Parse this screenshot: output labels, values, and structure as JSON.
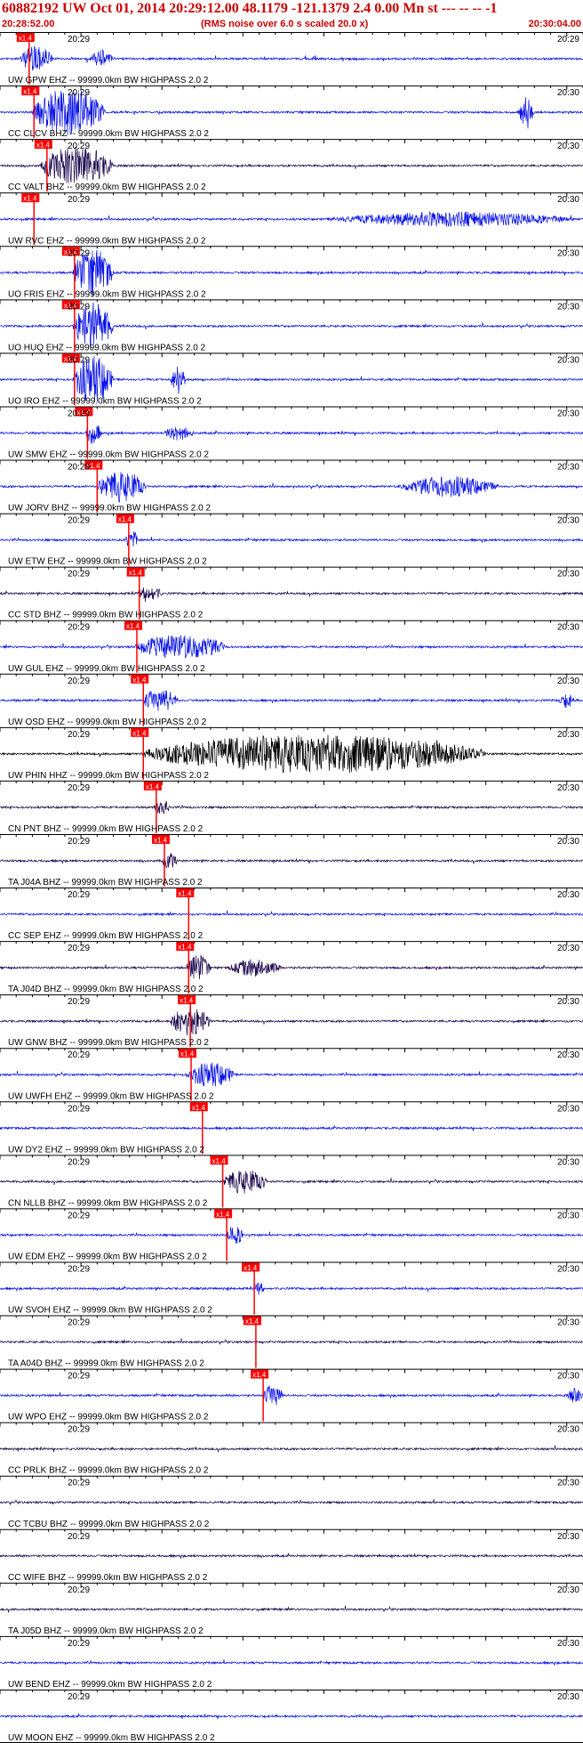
{
  "header": {
    "title": "60882192 UW Oct 01, 2014 20:29:12.00   48.1179 -121.1379  2.4 0.00 Mn st --- -- --   -1",
    "start_time": "20:28:52.00",
    "note": "(RMS noise over 6.0 s scaled 20.0 x)",
    "end_time": "20:30:04.00"
  },
  "colors": {
    "header_text": "#cc0000",
    "trace_blue": "#0a14e6",
    "trace_dark": "#1e0a50",
    "trace_black": "#000000",
    "pick": "#ff0000",
    "pick_label": "#ffffff"
  },
  "chart_data": {
    "type": "seismogram",
    "time_range": [
      "20:28:52.00",
      "20:30:04.00"
    ],
    "time_range_seconds": [
      0,
      72
    ],
    "pick_label": "x1.4",
    "traces": [
      {
        "label": "UW GPW EHZ -- 99999.0km BW  HIGHPASS  2.0  2",
        "time_labels": [
          "20:29",
          "20:29"
        ],
        "color": "blue",
        "pick_s": 3.6,
        "burst_s": [
          2.5,
          6.5
        ],
        "late_s": [
          11,
          14
        ],
        "amp": 0.55
      },
      {
        "label": "CC CLCV BHZ -- 99999.0km BW  HIGHPASS  2.0  2",
        "time_labels": [
          "20:29",
          "20:30"
        ],
        "color": "blue",
        "pick_s": 4.2,
        "burst_s": [
          4,
          13
        ],
        "late_s": [
          64,
          66
        ],
        "amp": 1.0
      },
      {
        "label": "CC VALT BHZ -- 99999.0km BW  HIGHPASS  2.0  2",
        "time_labels": [
          "20:29",
          "20:30"
        ],
        "color": "dark",
        "pick_s": 5.8,
        "burst_s": [
          5,
          14
        ],
        "late_s": [],
        "amp": 0.8
      },
      {
        "label": "UW RVC EHZ -- 99999.0km BW  HIGHPASS  2.0  2",
        "time_labels": [
          "20:29",
          "20:30"
        ],
        "color": "blue",
        "pick_s": 4.2,
        "burst_s": [],
        "late_s": [
          40,
          72
        ],
        "amp": 0.45
      },
      {
        "label": "UO FRIS EHZ -- 99999.0km BW  HIGHPASS  2.0  2",
        "time_labels": [
          "20:29",
          "20:30"
        ],
        "color": "blue",
        "pick_s": 9.2,
        "burst_s": [
          9,
          14
        ],
        "late_s": [],
        "amp": 1.0
      },
      {
        "label": "UO HUQ EHZ -- 99999.0km BW  HIGHPASS  2.0  2",
        "time_labels": [
          "20:29",
          "20:30"
        ],
        "color": "blue",
        "pick_s": 9.2,
        "burst_s": [
          9,
          14
        ],
        "late_s": [],
        "amp": 1.0
      },
      {
        "label": "UO IRO EHZ -- 99999.0km BW  HIGHPASS  2.0  2",
        "time_labels": [
          "20:29",
          "20:30"
        ],
        "color": "blue",
        "pick_s": 9.2,
        "burst_s": [
          9,
          14
        ],
        "late_s": [
          21,
          23
        ],
        "amp": 1.0
      },
      {
        "label": "UW SMW EHZ -- 99999.0km BW  HIGHPASS  2.0  2",
        "time_labels": [
          "20:29",
          "20:30"
        ],
        "color": "blue",
        "pick_s": 10.8,
        "burst_s": [
          10.5,
          12.5
        ],
        "late_s": [
          20,
          24
        ],
        "amp": 0.45
      },
      {
        "label": "UW JORV BHZ -- 99999.0km BW  HIGHPASS  2.0  2",
        "time_labels": [
          "20:29",
          "20:30"
        ],
        "color": "blue",
        "pick_s": 12.0,
        "burst_s": [
          12,
          18
        ],
        "late_s": [
          49,
          62
        ],
        "amp": 0.65
      },
      {
        "label": "UW ETW EHZ -- 99999.0km BW  HIGHPASS  2.0  2",
        "time_labels": [
          "20:29",
          "20:30"
        ],
        "color": "blue",
        "pick_s": 15.9,
        "burst_s": [
          15.5,
          17
        ],
        "late_s": [],
        "amp": 0.4
      },
      {
        "label": "CC STD BHZ -- 99999.0km BW  HIGHPASS  2.0  2",
        "time_labels": [
          "20:29",
          "20:30"
        ],
        "color": "dark",
        "pick_s": 17.2,
        "burst_s": [
          17,
          20
        ],
        "late_s": [],
        "amp": 0.3
      },
      {
        "label": "UW GUL EHZ -- 99999.0km BW  HIGHPASS  2.0  2",
        "time_labels": [
          "20:29",
          "20:30"
        ],
        "color": "blue",
        "pick_s": 16.9,
        "burst_s": [
          16.5,
          28
        ],
        "late_s": [],
        "amp": 0.5
      },
      {
        "label": "UW OSD EHZ -- 99999.0km BW  HIGHPASS  2.0  2",
        "time_labels": [
          "20:29",
          "20:30"
        ],
        "color": "blue",
        "pick_s": 17.7,
        "burst_s": [
          17.5,
          22
        ],
        "late_s": [
          69,
          71
        ],
        "amp": 0.45
      },
      {
        "label": "UW PHIN HHZ -- 99999.0km BW  HIGHPASS  2.0  2",
        "time_labels": [
          "20:29",
          "20:30"
        ],
        "color": "black",
        "pick_s": 17.7,
        "burst_s": [
          17.5,
          60
        ],
        "late_s": [],
        "amp": 0.8
      },
      {
        "label": "CN PNT BHZ -- 99999.0km BW  HIGHPASS  2.0  2",
        "time_labels": [
          "20:29",
          "20:30"
        ],
        "color": "dark",
        "pick_s": 19.3,
        "burst_s": [
          19,
          21
        ],
        "late_s": [],
        "amp": 0.3
      },
      {
        "label": "TA J04A BHZ -- 99999.0km BW  HIGHPASS  2.0  2",
        "time_labels": [
          "20:29",
          "20:30"
        ],
        "color": "dark",
        "pick_s": 20.3,
        "burst_s": [
          20,
          22
        ],
        "late_s": [],
        "amp": 0.3
      },
      {
        "label": "CC SEP EHZ -- 99999.0km BW  HIGHPASS  2.0  2",
        "time_labels": [
          "20:29",
          "20:30"
        ],
        "color": "blue",
        "pick_s": 23.3,
        "burst_s": [],
        "late_s": [],
        "amp": 0.15
      },
      {
        "label": "TA J04D BHZ -- 99999.0km BW  HIGHPASS  2.0  2",
        "time_labels": [
          "20:29",
          "20:30"
        ],
        "color": "dark",
        "pick_s": 23.3,
        "burst_s": [
          23,
          26
        ],
        "late_s": [
          28,
          35
        ],
        "amp": 0.55
      },
      {
        "label": "UW GNW BHZ -- 99999.0km BW  HIGHPASS  2.0  2",
        "time_labels": [
          "20:29",
          "20:30"
        ],
        "color": "dark",
        "pick_s": 23.5,
        "burst_s": [
          21,
          26
        ],
        "late_s": [],
        "amp": 0.6
      },
      {
        "label": "UW UWFH EHZ -- 99999.0km BW  HIGHPASS  2.0  2",
        "time_labels": [
          "20:29",
          "20:30"
        ],
        "color": "blue",
        "pick_s": 23.6,
        "burst_s": [
          23,
          29
        ],
        "late_s": [],
        "amp": 0.5
      },
      {
        "label": "UW DY2 EHZ -- 99999.0km BW  HIGHPASS  2.0  2",
        "time_labels": [
          "20:29",
          "20:30"
        ],
        "color": "blue",
        "pick_s": 25.0,
        "burst_s": [],
        "late_s": [],
        "amp": 0.2
      },
      {
        "label": "CN NLLB BHZ -- 99999.0km BW  HIGHPASS  2.0  2",
        "time_labels": [
          "20:29",
          "20:30"
        ],
        "color": "dark",
        "pick_s": 27.5,
        "burst_s": [
          27.5,
          33
        ],
        "late_s": [],
        "amp": 0.5
      },
      {
        "label": "UW EDM EHZ -- 99999.0km BW  HIGHPASS  2.0  2",
        "time_labels": [
          "20:29",
          "20:30"
        ],
        "color": "blue",
        "pick_s": 28.0,
        "burst_s": [
          28,
          30
        ],
        "late_s": [],
        "amp": 0.4
      },
      {
        "label": "UW SVOH EHZ -- 99999.0km BW  HIGHPASS  2.0  2",
        "time_labels": [
          "20:29",
          "20:30"
        ],
        "color": "blue",
        "pick_s": 31.4,
        "burst_s": [
          31.5,
          32.5
        ],
        "late_s": [],
        "amp": 0.3
      },
      {
        "label": "TA A04D BHZ -- 99999.0km BW  HIGHPASS  2.0  2",
        "time_labels": [
          "20:29",
          "20:30"
        ],
        "color": "dark",
        "pick_s": 31.6,
        "burst_s": [],
        "late_s": [],
        "amp": 0.25
      },
      {
        "label": "UW WPO EHZ -- 99999.0km BW  HIGHPASS  2.0  2",
        "time_labels": [
          "20:29",
          "20:30"
        ],
        "color": "blue",
        "pick_s": 32.5,
        "burst_s": [
          32.5,
          35
        ],
        "late_s": [
          70,
          72
        ],
        "amp": 0.45
      },
      {
        "label": "CC PRLK BHZ -- 99999.0km BW  HIGHPASS  2.0  2",
        "time_labels": [
          "20:29",
          "20:30"
        ],
        "color": "dark",
        "pick_s": null,
        "burst_s": [],
        "late_s": [],
        "amp": 0.25
      },
      {
        "label": "CC TCBU BHZ -- 99999.0km BW  HIGHPASS  2.0  2",
        "time_labels": [
          "20:29",
          "20:30"
        ],
        "color": "dark",
        "pick_s": null,
        "burst_s": [],
        "late_s": [],
        "amp": 0.25
      },
      {
        "label": "CC WIFE BHZ -- 99999.0km BW  HIGHPASS  2.0  2",
        "time_labels": [
          "20:29",
          "20:30"
        ],
        "color": "dark",
        "pick_s": null,
        "burst_s": [],
        "late_s": [],
        "amp": 0.25
      },
      {
        "label": "TA J05D BHZ -- 99999.0km BW  HIGHPASS  2.0  2",
        "time_labels": [
          "20:29",
          "20:30"
        ],
        "color": "dark",
        "pick_s": null,
        "burst_s": [],
        "late_s": [],
        "amp": 0.25
      },
      {
        "label": "UW BEND EHZ -- 99999.0km BW  HIGHPASS  2.0  2",
        "time_labels": [
          "20:29",
          "20:30"
        ],
        "color": "blue",
        "pick_s": null,
        "burst_s": [],
        "late_s": [],
        "amp": 0.3
      },
      {
        "label": "UW MOON EHZ -- 99999.0km BW  HIGHPASS  2.0  2",
        "time_labels": [
          "20:29",
          "20:30"
        ],
        "color": "blue",
        "pick_s": null,
        "burst_s": [],
        "late_s": [],
        "amp": 0.3
      }
    ]
  }
}
